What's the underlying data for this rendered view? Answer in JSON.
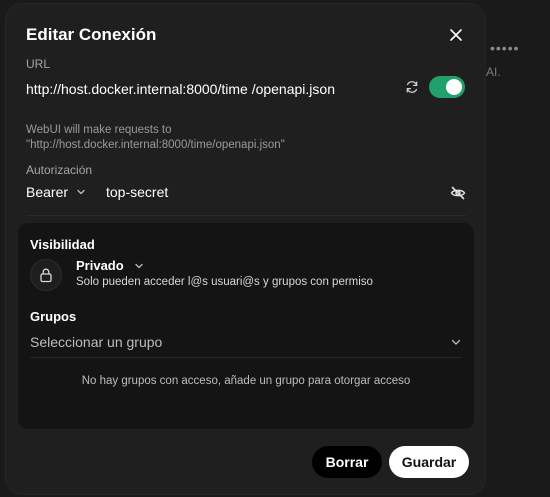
{
  "background": {
    "dots": "•••••",
    "text": "AI."
  },
  "modal": {
    "title": "Editar Conexión",
    "url_label": "URL",
    "url_value": "http://host.docker.internal:8000/time /openapi.json",
    "toggle_enabled": true,
    "help_text": "WebUI will make requests to \"http://host.docker.internal:8000/time/openapi.json\"",
    "auth_label": "Autorización",
    "auth_type": "Bearer",
    "auth_value": "top-secret",
    "visibility": {
      "heading": "Visibilidad",
      "selected": "Privado",
      "description": "Solo pueden acceder l@s usuari@s y grupos con permiso"
    },
    "groups": {
      "heading": "Grupos",
      "placeholder": "Seleccionar un grupo",
      "empty_text": "No hay grupos con acceso, añade un grupo para otorgar acceso"
    },
    "buttons": {
      "delete": "Borrar",
      "save": "Guardar"
    }
  },
  "colors": {
    "accent_toggle": "#22a06b",
    "modal_bg": "#1f1f1f",
    "panel_bg": "#141414"
  },
  "icons": [
    "close-icon",
    "refresh-icon",
    "eye-off-icon",
    "lock-icon",
    "chevron-down-icon"
  ]
}
